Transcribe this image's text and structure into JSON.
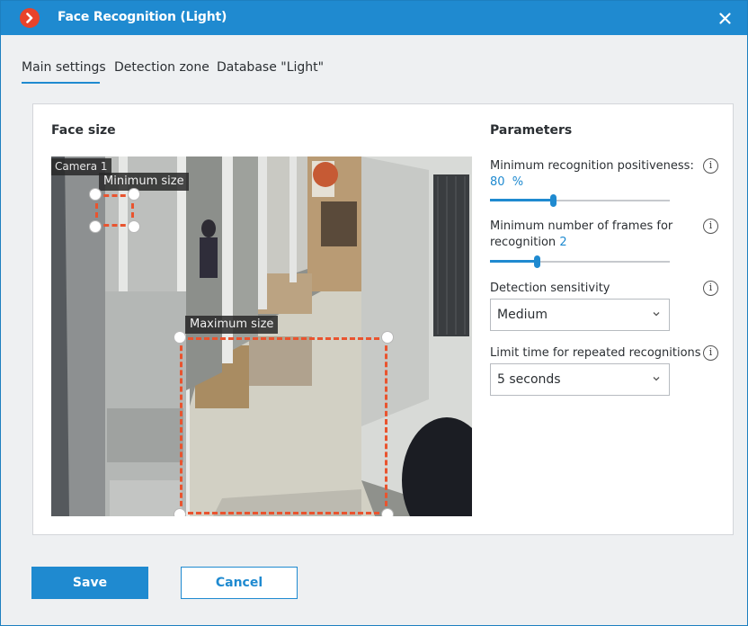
{
  "window": {
    "title": "Face Recognition (Light)",
    "logo_icon": "app-logo-chevron",
    "close_icon": "close-icon"
  },
  "tabs": [
    {
      "label": "Main settings",
      "active": true
    },
    {
      "label": "Detection zone",
      "active": false
    },
    {
      "label": "Database \"Light\"",
      "active": false
    }
  ],
  "face_size": {
    "title": "Face size",
    "camera_label": "Camera 1",
    "minimum_label": "Minimum size",
    "maximum_label": "Maximum size"
  },
  "parameters": {
    "title": "Parameters",
    "positiveness": {
      "label": "Minimum recognition positiveness:",
      "value": "80",
      "unit": "%",
      "fraction": 0.35
    },
    "frames": {
      "label_line1": "Minimum number of frames for",
      "label_line2": "recognition",
      "value": "2",
      "fraction": 0.26
    },
    "sensitivity": {
      "label": "Detection sensitivity",
      "selected": "Medium"
    },
    "repeat_limit": {
      "label": "Limit time for repeated recognitions",
      "selected": "5 seconds"
    },
    "info_icon": "info-icon"
  },
  "buttons": {
    "save": "Save",
    "cancel": "Cancel"
  },
  "colors": {
    "accent": "#1f8ad0",
    "logo": "#e8432b",
    "zone_border": "#e9542f"
  }
}
